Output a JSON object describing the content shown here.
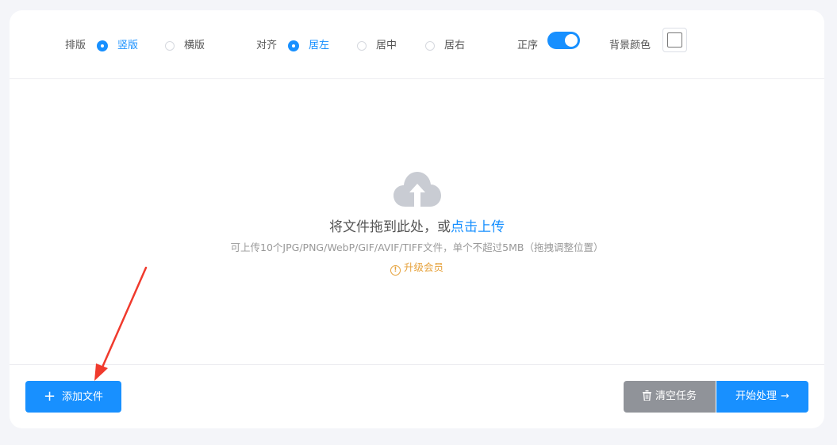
{
  "options": {
    "layout_label": "排版",
    "layout_options": [
      {
        "label": "竖版",
        "checked": true
      },
      {
        "label": "横版",
        "checked": false
      }
    ],
    "align_label": "对齐",
    "align_options": [
      {
        "label": "居左",
        "checked": true
      },
      {
        "label": "居中",
        "checked": false
      },
      {
        "label": "居右",
        "checked": false
      }
    ],
    "order_label": "正序",
    "order_on": true,
    "bg_color_label": "背景颜色",
    "bg_color": "#ffffff"
  },
  "dropzone": {
    "icon": "cloud-upload-icon",
    "title_prefix": "将文件拖到此处，或",
    "title_link": "点击上传",
    "hint": "可上传10个JPG/PNG/WebP/GIF/AVIF/TIFF文件，单个不超过5MB（拖拽调整位置）",
    "upgrade": "升级会员",
    "upgrade_icon": "warning-circle-icon"
  },
  "footer": {
    "add_label": "添加文件",
    "clear_label": "清空任务",
    "start_label": "开始处理"
  },
  "colors": {
    "accent": "#1890ff",
    "clear_button": "#909399",
    "upgrade": "#e6a23c",
    "annotation_arrow": "#f03a2d"
  }
}
